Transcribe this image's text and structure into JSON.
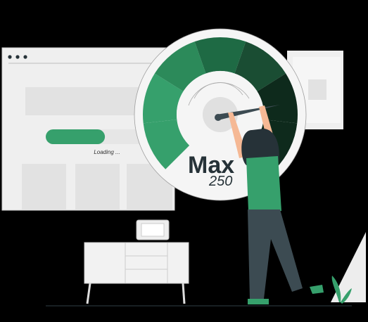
{
  "browser": {
    "loading_text": "Loading ...",
    "progress_percent": 58
  },
  "gauge": {
    "label": "Max",
    "value": "250"
  },
  "colors": {
    "green_light": "#36a06c",
    "green_mid": "#2c8a5a",
    "green_dark": "#1e6a44",
    "green_darker": "#1a4d33",
    "green_darkest": "#0e2a1c",
    "window_bg": "#efefef",
    "block": "#e2e2e2",
    "ink": "#263238"
  }
}
